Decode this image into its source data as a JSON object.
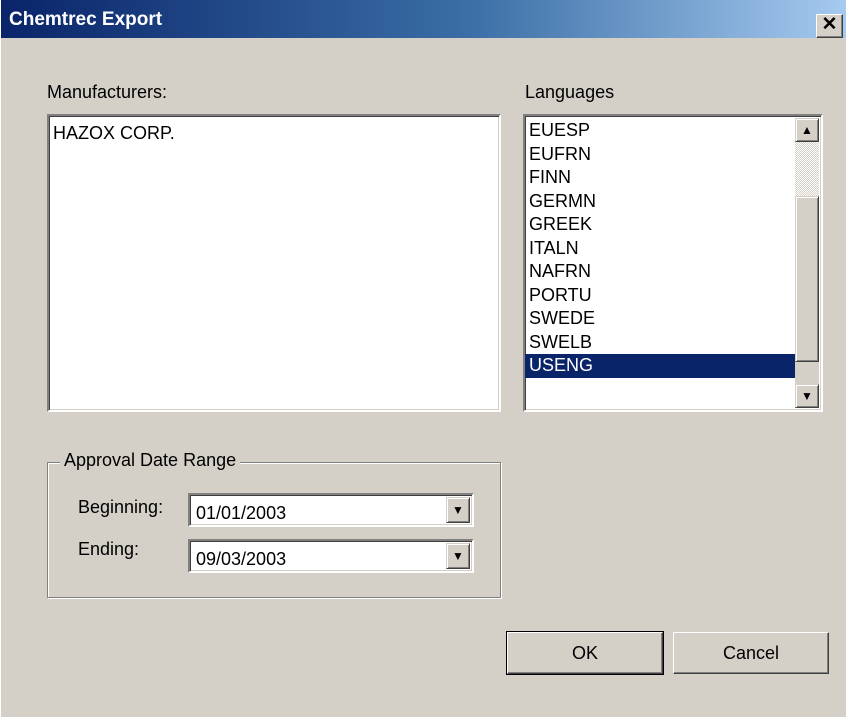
{
  "window": {
    "title": "Chemtrec Export",
    "close_glyph": "✕"
  },
  "manufacturers": {
    "label": "Manufacturers:",
    "items": [
      "HAZOX CORP."
    ]
  },
  "languages": {
    "label": "Languages",
    "items": [
      "EUESP",
      "EUFRN",
      "FINN",
      "GERMN",
      "GREEK",
      "ITALN",
      "NAFRN",
      "PORTU",
      "SWEDE",
      "SWELB",
      "USENG"
    ],
    "selected": "USENG",
    "scroll_up_glyph": "▲",
    "scroll_down_glyph": "▼"
  },
  "approval_date_range": {
    "legend": "Approval Date Range",
    "beginning_label": "Beginning:",
    "beginning_value": "01/01/2003",
    "ending_label": "Ending:",
    "ending_value": "09/03/2003",
    "dropdown_glyph": "▼"
  },
  "buttons": {
    "ok": "OK",
    "cancel": "Cancel"
  },
  "colors": {
    "title_start": "#0a246a",
    "title_end": "#a6caf0",
    "selection": "#0a246a",
    "face": "#d4d0c8"
  }
}
